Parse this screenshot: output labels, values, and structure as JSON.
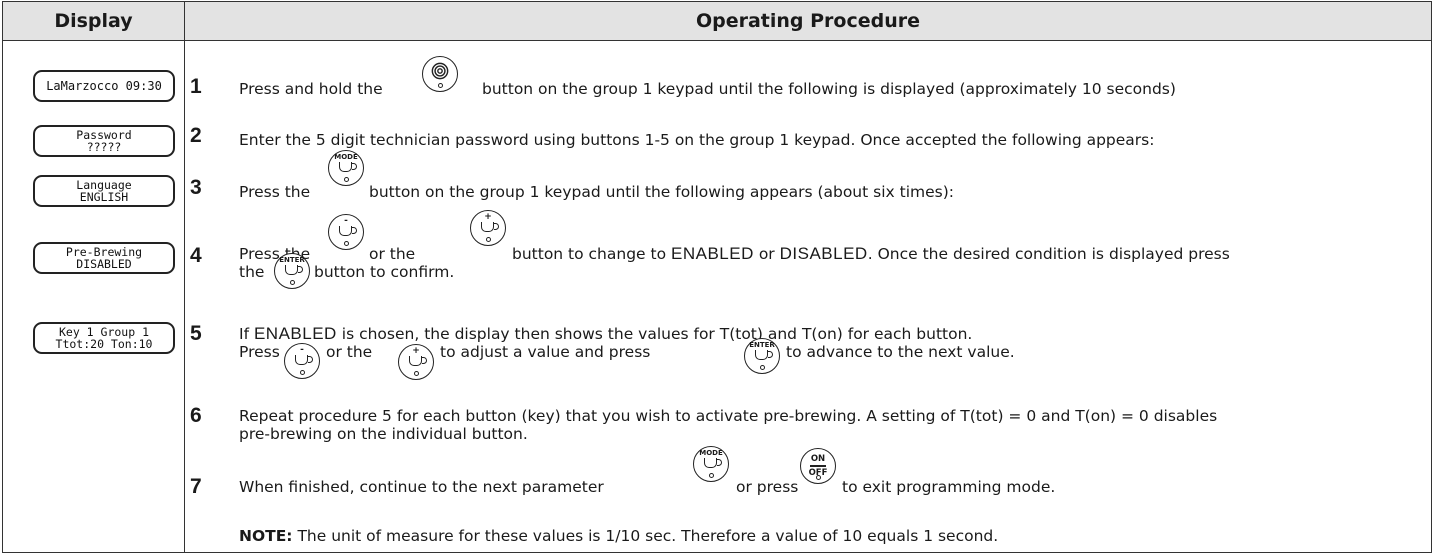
{
  "header": {
    "display": "Display",
    "procedure": "Operating Procedure"
  },
  "lcd": {
    "s1": [
      "LaMarzocco 09:30"
    ],
    "s2": [
      "Password",
      "?????"
    ],
    "s3": [
      "Language",
      "ENGLISH"
    ],
    "s4": [
      "Pre-Brewing",
      "DISABLED"
    ],
    "s5": [
      "Key 1 Group 1",
      "Ttot:20 Ton:10"
    ]
  },
  "steps": {
    "s1": {
      "num": "1",
      "a": "Press and hold the",
      "b": "button on the group 1 keypad until the following is displayed (approximately 10 seconds)"
    },
    "s2": {
      "num": "2",
      "a": "Enter the 5 digit technician password using buttons 1-5 on the group 1 keypad. Once accepted the following appears:"
    },
    "s3": {
      "num": "3",
      "a": "Press the",
      "b": "button on the group 1 keypad until the following appears (about six times):"
    },
    "s4": {
      "num": "4",
      "a": "Press the",
      "b": "or the",
      "c": "button to change to",
      "enabled": "ENABLED",
      "or": "or",
      "disabled": "DISABLED",
      "d": ". Once the desired condition is displayed press",
      "e": "the",
      "f": "button to confirm."
    },
    "s5": {
      "num": "5",
      "a": "If",
      "enabled": "ENABLED",
      "b": "is chosen, the display then shows the values for T(tot) and T(on) for each button.",
      "c": "Press",
      "d": "or the",
      "e": "to adjust a value and press",
      "f": "to advance to the next value."
    },
    "s6": {
      "num": "6",
      "a": "Repeat procedure 5 for each button (key) that you wish to activate pre-brewing. A setting of T(tot) = 0 and T(on) = 0 disables",
      "b": "pre-brewing on the individual button."
    },
    "s7": {
      "num": "7",
      "a": "When finished, continue to the next parameter",
      "b": "or press",
      "c": "to exit programming mode."
    }
  },
  "note": {
    "label": "NOTE:",
    "text": "The unit of measure for these values is 1/10 sec. Therefore a value of 10 equals 1 second."
  },
  "buttons": {
    "mode": "MODE",
    "enter": "ENTER",
    "minus": "-",
    "plus": "+",
    "on": "ON",
    "off": "OFF"
  }
}
